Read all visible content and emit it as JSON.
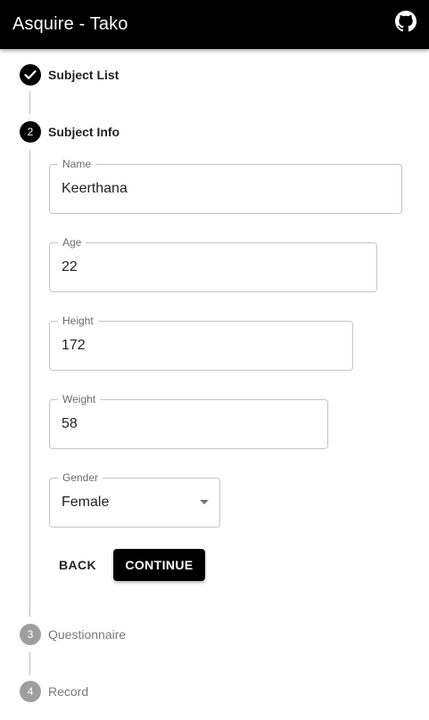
{
  "app": {
    "title": "Asquire - Tako"
  },
  "steps": [
    {
      "number": "1",
      "label": "Subject List",
      "state": "completed"
    },
    {
      "number": "2",
      "label": "Subject Info",
      "state": "active"
    },
    {
      "number": "3",
      "label": "Questionnaire",
      "state": "inactive"
    },
    {
      "number": "4",
      "label": "Record",
      "state": "inactive"
    }
  ],
  "form": {
    "name": {
      "label": "Name",
      "value": "Keerthana"
    },
    "age": {
      "label": "Age",
      "value": "22"
    },
    "height": {
      "label": "Height",
      "value": "172"
    },
    "weight": {
      "label": "Weight",
      "value": "58"
    },
    "gender": {
      "label": "Gender",
      "value": "Female"
    }
  },
  "actions": {
    "back_label": "Back",
    "continue_label": "Continue"
  },
  "icons": {
    "appbar_right": "github-icon",
    "completed_step": "check-icon",
    "select": "caret-down-icon"
  },
  "colors": {
    "appbar_bg": "#000000",
    "primary": "#000000",
    "inactive_step": "#9e9e9e"
  }
}
